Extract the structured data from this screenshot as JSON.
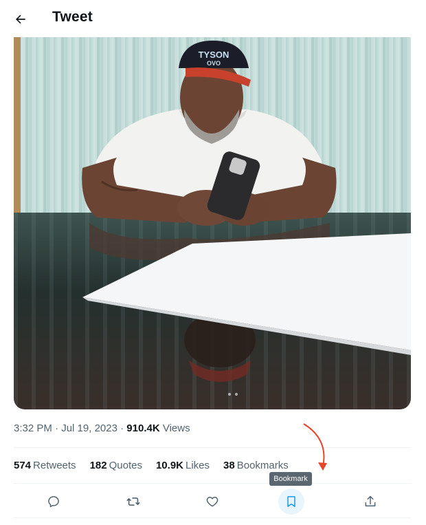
{
  "header": {
    "title": "Tweet",
    "back_icon": "arrow-left-icon"
  },
  "media": {
    "icon": "photo",
    "colors": {
      "curtain": "#bcd9d6",
      "table": "#2c3a38",
      "shirt": "#f2f2f0",
      "skin": "#6b4434",
      "cap": "#1b1d28",
      "cap_brim": "#c8412c"
    }
  },
  "meta": {
    "time": "3:32 PM",
    "separator1": " · ",
    "date": "Jul 19, 2023",
    "separator2": " · ",
    "views_count": "910.4K",
    "views_label": " Views"
  },
  "stats": {
    "retweets_count": "574",
    "retweets_label": "Retweets",
    "quotes_count": "182",
    "quotes_label": "Quotes",
    "likes_count": "10.9K",
    "likes_label": "Likes",
    "bookmarks_count": "38",
    "bookmarks_label": "Bookmarks"
  },
  "actions": {
    "items": [
      {
        "name": "reply",
        "icon": "reply-icon"
      },
      {
        "name": "retweet",
        "icon": "retweet-icon"
      },
      {
        "name": "like",
        "icon": "heart-icon"
      },
      {
        "name": "bookmark",
        "icon": "bookmark-icon",
        "active": true
      },
      {
        "name": "share",
        "icon": "share-icon"
      }
    ]
  },
  "tooltip": {
    "text": "Bookmark"
  },
  "colors": {
    "text_primary": "#0f1419",
    "text_secondary": "#536471",
    "divider": "#eff3f4",
    "accent": "#1d9bf0",
    "annotation": "#e8452c"
  }
}
